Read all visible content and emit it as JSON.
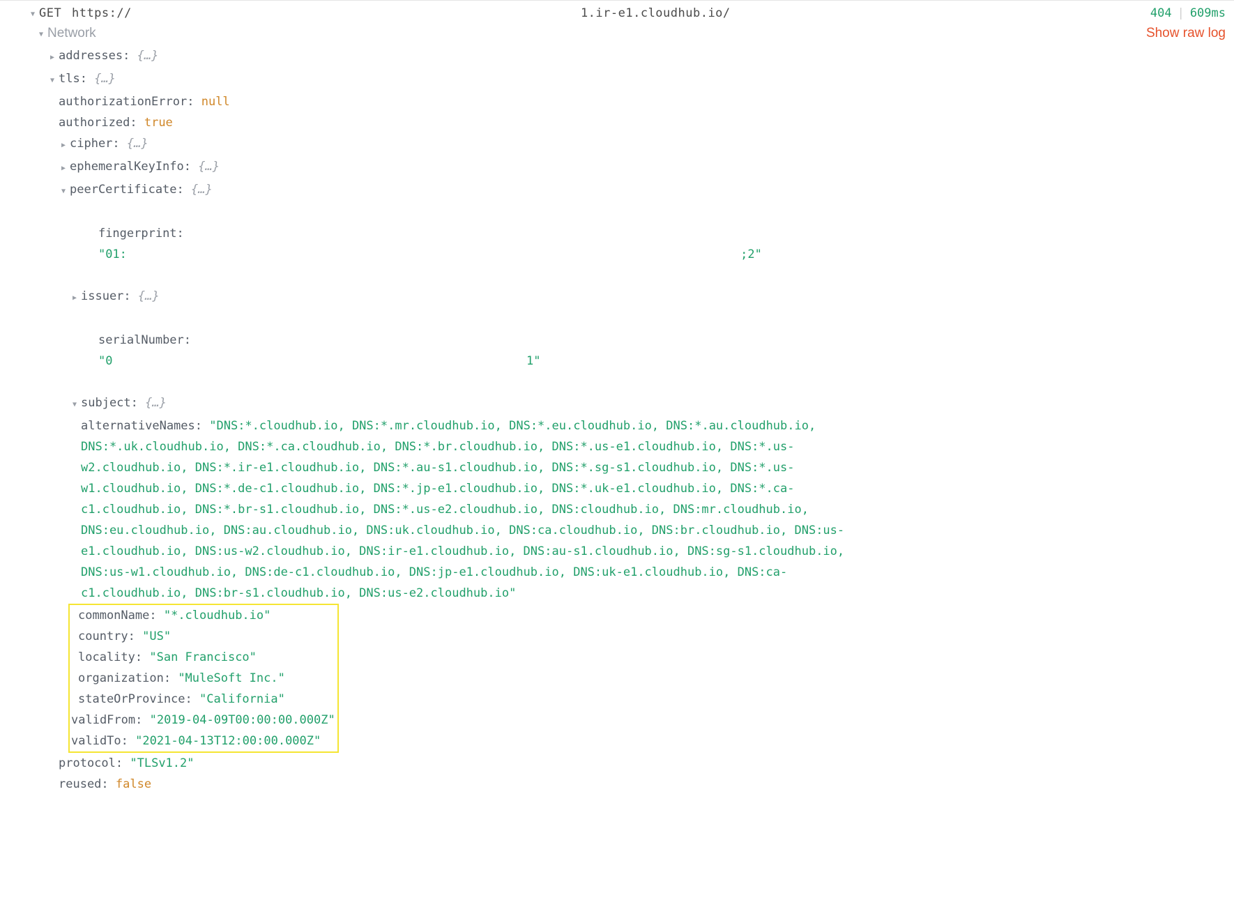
{
  "header": {
    "method": "GET",
    "url_prefix": "https://",
    "url_mid": "                                                            1.ir-e1.cloudhub.io/",
    "status": "404",
    "time": "609ms"
  },
  "network_label": "Network",
  "show_raw_label": "Show raw log",
  "addresses_key": "addresses:",
  "tls_key": "tls:",
  "authorizationError_key": "authorizationError:",
  "authorizationError_val": "null",
  "authorized_key": "authorized:",
  "authorized_val": "true",
  "cipher_key": "cipher:",
  "ephemeralKeyInfo_key": "ephemeralKeyInfo:",
  "peerCertificate_key": "peerCertificate:",
  "fingerprint_key": "fingerprint:",
  "fingerprint_val_a": "\"01:",
  "fingerprint_val_b": "                                                                                      ;2\"",
  "issuer_key": "issuer:",
  "serialNumber_key": "serialNumber:",
  "serialNumber_val_a": "\"0",
  "serialNumber_val_b": "                                                          1\"",
  "subject_key": "subject:",
  "altn_key": "alternativeNames:",
  "altn_val": "\"DNS:*.cloudhub.io, DNS:*.mr.cloudhub.io, DNS:*.eu.cloudhub.io, DNS:*.au.cloudhub.io, DNS:*.uk.cloudhub.io, DNS:*.ca.cloudhub.io, DNS:*.br.cloudhub.io, DNS:*.us-e1.cloudhub.io, DNS:*.us-w2.cloudhub.io, DNS:*.ir-e1.cloudhub.io, DNS:*.au-s1.cloudhub.io, DNS:*.sg-s1.cloudhub.io, DNS:*.us-w1.cloudhub.io, DNS:*.de-c1.cloudhub.io, DNS:*.jp-e1.cloudhub.io, DNS:*.uk-e1.cloudhub.io, DNS:*.ca-c1.cloudhub.io, DNS:*.br-s1.cloudhub.io, DNS:*.us-e2.cloudhub.io, DNS:cloudhub.io, DNS:mr.cloudhub.io, DNS:eu.cloudhub.io, DNS:au.cloudhub.io, DNS:uk.cloudhub.io, DNS:ca.cloudhub.io, DNS:br.cloudhub.io, DNS:us-e1.cloudhub.io, DNS:us-w2.cloudhub.io, DNS:ir-e1.cloudhub.io, DNS:au-s1.cloudhub.io, DNS:sg-s1.cloudhub.io, DNS:us-w1.cloudhub.io, DNS:de-c1.cloudhub.io, DNS:jp-e1.cloudhub.io, DNS:uk-e1.cloudhub.io, DNS:ca-c1.cloudhub.io, DNS:br-s1.cloudhub.io, DNS:us-e2.cloudhub.io\"",
  "commonName_key": "commonName:",
  "commonName_val": "\"*.cloudhub.io\"",
  "country_key": "country:",
  "country_val": "\"US\"",
  "locality_key": "locality:",
  "locality_val": "\"San Francisco\"",
  "organization_key": "organization:",
  "organization_val": "\"MuleSoft Inc.\"",
  "state_key": "stateOrProvince:",
  "state_val": "\"California\"",
  "validFrom_key": "validFrom:",
  "validFrom_val": "\"2019-04-09T00:00:00.000Z\"",
  "validTo_key": "validTo:",
  "validTo_val": "\"2021-04-13T12:00:00.000Z\"",
  "protocol_key": "protocol:",
  "protocol_val": "\"TLSv1.2\"",
  "reused_key": "reused:",
  "reused_val": "false",
  "placeholder": "{…}"
}
